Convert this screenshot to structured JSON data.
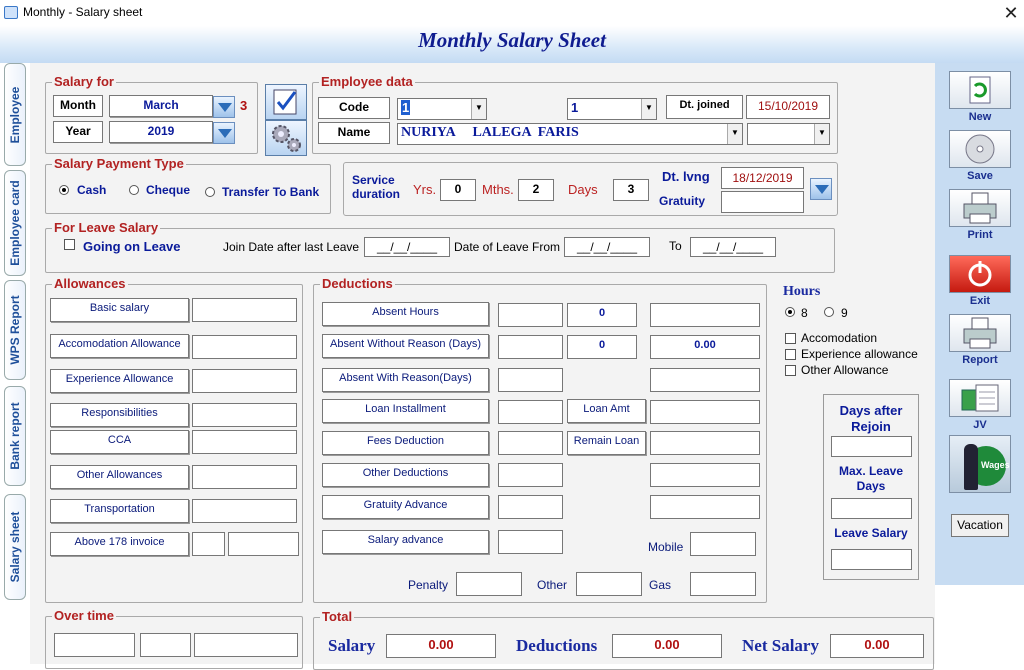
{
  "window": {
    "title": "Monthly - Salary sheet"
  },
  "header": {
    "title": "Monthly Salary Sheet"
  },
  "side_tabs": [
    "Employee",
    "Employee card",
    "WPS Report",
    "Bank report",
    "Salary sheet"
  ],
  "salary_for": {
    "legend": "Salary for",
    "month_label": "Month",
    "month_value": "March",
    "month_number": "3",
    "year_label": "Year",
    "year_value": "2019"
  },
  "employee": {
    "legend": "Employee data",
    "code_label": "Code",
    "code_value": "1",
    "code2_value": "1",
    "dt_joined_label": "Dt. joined",
    "dt_joined_value": "15/10/2019",
    "name_label": "Name",
    "name_value": "NURIYA     LALEGA  FARIS"
  },
  "payment": {
    "legend": "Salary Payment Type",
    "options": [
      "Cash",
      "Cheque",
      "Transfer To Bank"
    ],
    "selected": "Cash"
  },
  "service": {
    "label1": "Service",
    "label2": "duration",
    "yrs_label": "Yrs.",
    "yrs_value": "0",
    "mths_label": "Mths.",
    "mths_value": "2",
    "days_label": "Days",
    "days_value": "3",
    "dt_lvng_label": "Dt. lvng",
    "dt_lvng_value": "18/12/2019",
    "gratuity_label": "Gratuity"
  },
  "leave": {
    "legend": "For Leave Salary",
    "going_on_leave": "Going on Leave",
    "join_date_label": "Join Date after last Leave",
    "date_from_label": "Date of Leave From",
    "to_label": "To",
    "date_mask": "__/__/____"
  },
  "allowances": {
    "legend": "Allowances",
    "items": [
      "Basic salary",
      "Accomodation Allowance",
      "Experience Allowance",
      "Responsibilities",
      "CCA",
      "Other Allowances",
      "Transportation",
      "Above 178  invoice"
    ]
  },
  "deductions": {
    "legend": "Deductions",
    "items": [
      "Absent Hours",
      "Absent Without Reason (Days)",
      "Absent With Reason(Days)",
      "Loan  Installment",
      "Fees Deduction",
      "Other Deductions",
      "Gratuity Advance",
      "Salary advance"
    ],
    "absent_hours_value": "0",
    "absent_wo_reason_value": "0",
    "absent_wo_reason_amount": "0.00",
    "loan_amt_label": "Loan  Amt",
    "remain_loan_label": "Remain Loan",
    "mobile_label": "Mobile",
    "penalty_label": "Penalty",
    "other_label": "Other",
    "gas_label": "Gas"
  },
  "hours": {
    "label": "Hours",
    "options": [
      "8",
      "9"
    ],
    "selected": "8",
    "checks": [
      "Accomodation",
      "Experience allowance",
      "Other Allowance"
    ]
  },
  "rejoin": {
    "days_after_rejoin": "Days after Rejoin",
    "max_leave_days": "Max. Leave Days",
    "leave_salary": "Leave Salary"
  },
  "overtime": {
    "legend": "Over time"
  },
  "total": {
    "legend": "Total",
    "salary_label": "Salary",
    "salary_value": "0.00",
    "deductions_label": "Deductions",
    "deductions_value": "0.00",
    "net_label": "Net Salary",
    "net_value": "0.00"
  },
  "toolbar": {
    "new": "New",
    "save": "Save",
    "print": "Print",
    "exit": "Exit",
    "report": "Report",
    "jv": "JV",
    "wages": "Wages",
    "vacation": "Vacation"
  }
}
